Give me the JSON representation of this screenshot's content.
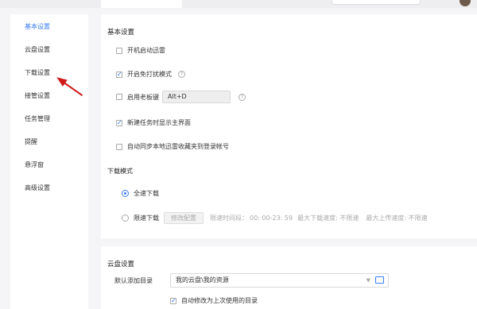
{
  "sidebar": {
    "items": [
      {
        "label": "基本设置"
      },
      {
        "label": "云盘设置"
      },
      {
        "label": "下载设置"
      },
      {
        "label": "接管设置"
      },
      {
        "label": "任务管理"
      },
      {
        "label": "提醒"
      },
      {
        "label": "悬浮窗"
      },
      {
        "label": "高级设置"
      }
    ]
  },
  "basic": {
    "title": "基本设置",
    "autostart_label": "开机启动迅雷",
    "dnd_label": "开启免打扰模式",
    "bosskey_label": "启用老板键",
    "bosskey_value": "Alt+D",
    "show_main_label": "新建任务时显示主界面",
    "sync_fav_label": "自动同步本地迅雷收藏夹到登录帐号",
    "download_mode_title": "下载模式",
    "full_speed_label": "全速下载",
    "limit_label": "限速下载",
    "modify_config_label": "修改配置",
    "limit_period": "限速时间段：",
    "limit_time": "00: 00-23: 59",
    "max_down": "最大下载速度: 不限速",
    "max_up": "最大上传速度: 不限速"
  },
  "cloud": {
    "title": "云盘设置",
    "default_dir_label": "默认添加目录",
    "default_dir_value": "我的云盘\\我的资源",
    "auto_modify_label": "自动修改为上次使用的目录"
  },
  "colors": {
    "accent": "#3a7cf5",
    "arrow": "#d01818"
  }
}
